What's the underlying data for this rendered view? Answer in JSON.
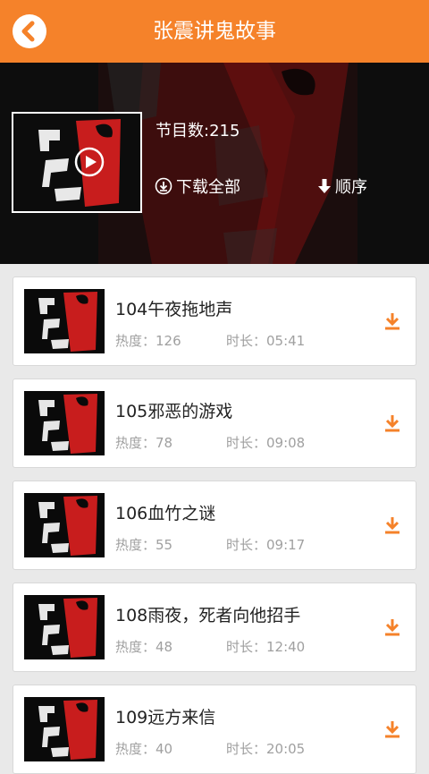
{
  "header": {
    "title": "张震讲鬼故事",
    "back_icon": "back-arrow-icon"
  },
  "banner": {
    "count_label": "节目数:215",
    "download_all_label": "下载全部",
    "order_label": "顺序",
    "cover_icon": "play-icon"
  },
  "colors": {
    "accent": "#f5822a",
    "card_bg": "#ffffff",
    "page_bg": "#e9e9e9",
    "meta_text": "#a0a0a0"
  },
  "episodes": [
    {
      "title": "104午夜拖地声",
      "hot": "热度：126",
      "duration": "时长：05:41"
    },
    {
      "title": "105邪恶的游戏",
      "hot": "热度：78",
      "duration": "时长：09:08"
    },
    {
      "title": "106血竹之谜",
      "hot": "热度：55",
      "duration": "时长：09:17"
    },
    {
      "title": "108雨夜，死者向他招手",
      "hot": "热度：48",
      "duration": "时长：12:40"
    },
    {
      "title": "109远方来信",
      "hot": "热度：40",
      "duration": "时长：20:05"
    }
  ]
}
